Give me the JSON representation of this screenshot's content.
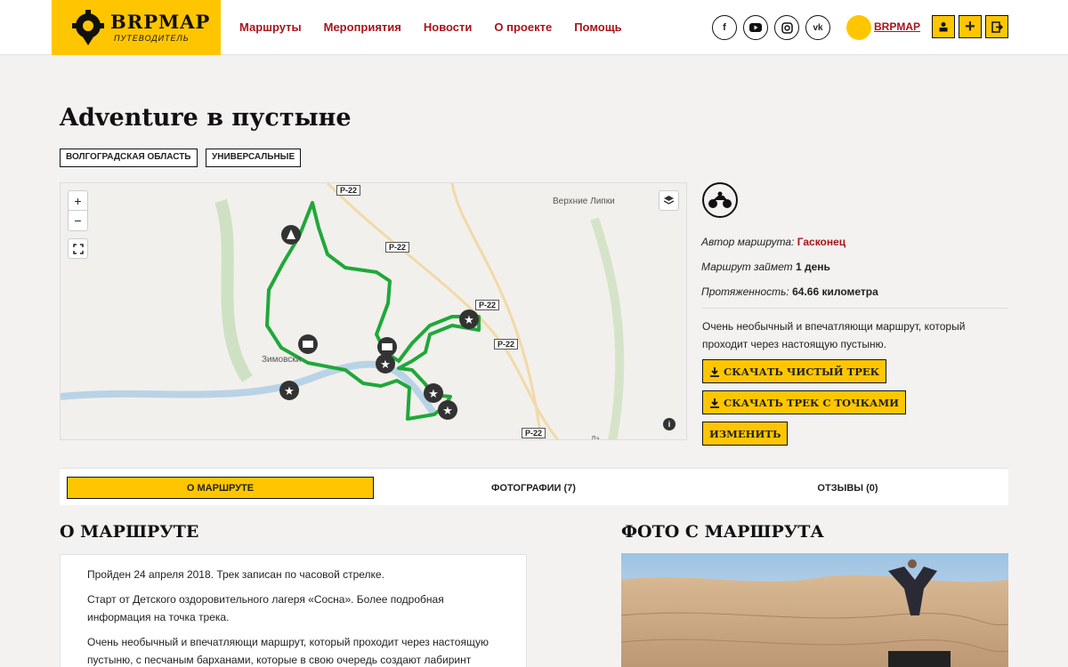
{
  "header": {
    "logo_text": "BRPMAP",
    "logo_sub": "ПУТЕВОДИТЕЛЬ",
    "nav": [
      "Маршруты",
      "Мероприятия",
      "Новости",
      "О проекте",
      "Помощь"
    ],
    "social": [
      "facebook-icon",
      "youtube-icon",
      "instagram-icon",
      "vk-icon"
    ],
    "user_name": "BRPMAP",
    "colors": {
      "accent": "#ffc600",
      "link": "#a8141b"
    }
  },
  "page": {
    "title": "Adventure в пустыне",
    "tags": [
      "ВОЛГОГРАДСКАЯ ОБЛАСТЬ",
      "УНИВЕРСАЛЬНЫЕ"
    ]
  },
  "map": {
    "zoom_in": "+",
    "zoom_out": "−",
    "labels": {
      "verkhnie_lipki": "Верхние Липки",
      "zimovsky": "Зимовски",
      "dal": "Дэ"
    },
    "road_label": "Р-22"
  },
  "route": {
    "author_label": "Автор маршрута:",
    "author_name": "Гасконец",
    "duration_label": "Маршрут займет",
    "duration_value": "1 день",
    "length_label": "Протяженность:",
    "length_value": "64.66 километра",
    "description": "Очень необычный и впечатляющи маршрут, который проходит через настоящую пустыню.",
    "btn_clean": "СКАЧАТЬ ЧИСТЫЙ ТРЕК",
    "btn_points": "СКАЧАТЬ ТРЕК С ТОЧКАМИ",
    "btn_edit": "ИЗМЕНИТЬ"
  },
  "tabs": [
    "О МАРШРУТЕ",
    "ФОТОГРАФИИ (7)",
    "ОТЗЫВЫ (0)"
  ],
  "about": {
    "heading": "О МАРШРУТЕ",
    "p1": "Пройден 24 апреля 2018. Трек записан по часовой стрелке.",
    "p2": "Старт от Детского оздоровительного лагеря «Сосна». Более подробная информация на точка трека.",
    "p3": "Очень необычный и впечатляющи маршрут, который проходит через настоящую пустыню, с песчаным барханами, которые в свою очередь создают лабиринт"
  },
  "photos": {
    "heading": "ФОТО С МАРШРУТА"
  }
}
